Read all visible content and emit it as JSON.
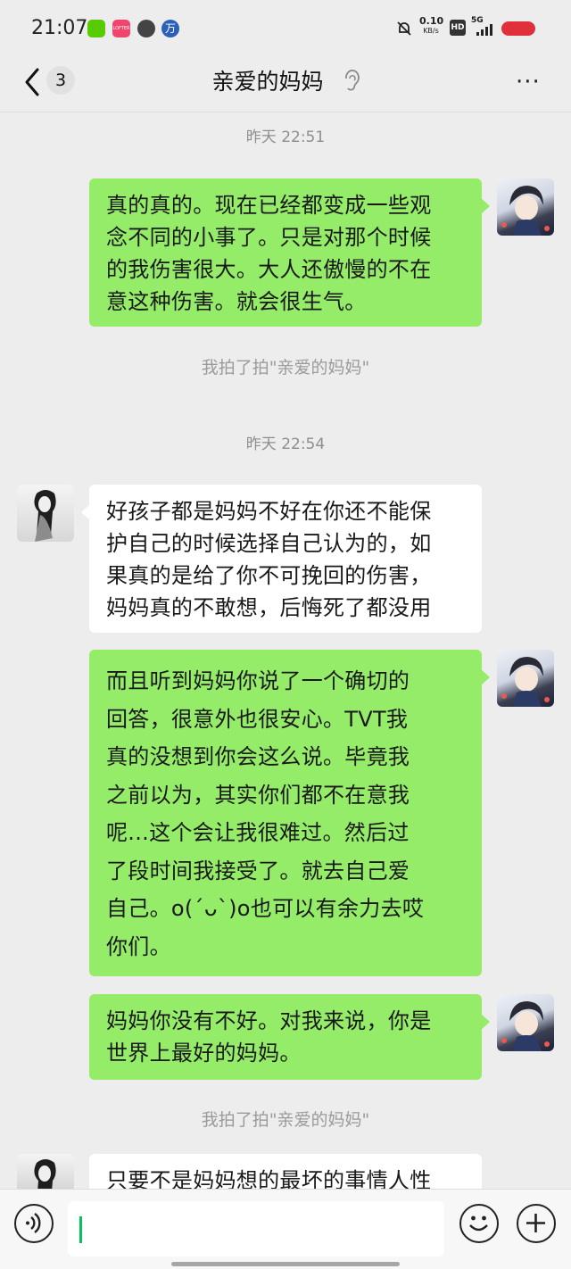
{
  "status_bar": {
    "time": "21:07",
    "net_speed_top": "0.10",
    "net_speed_bottom": "KB/s",
    "hd_label": "HD",
    "network_label": "5G",
    "app_icons": [
      "duolingo-icon",
      "lofter-icon",
      "camera-app-icon",
      "wanfang-icon"
    ],
    "wanfang_glyph": "万",
    "lofter_glyph": "LOFTER"
  },
  "header": {
    "unread_count": "3",
    "title": "亲爱的妈妈",
    "more_glyph": "···"
  },
  "colors": {
    "outgoing_bubble": "#95ec69",
    "incoming_bubble": "#ffffff",
    "background": "#ededed",
    "cursor": "#07c160",
    "battery": "#e0303a"
  },
  "messages": [
    {
      "type": "timestamp",
      "text": "昨天 22:51"
    },
    {
      "type": "outgoing",
      "lines": [
        "真的真的。现在已经都变成一些观",
        "念不同的小事了。只是对那个时候",
        "的我伤害很大。大人还傲慢的不在",
        "意这种伤害。就会很生气。"
      ]
    },
    {
      "type": "system",
      "text": "我拍了拍\"亲爱的妈妈\""
    },
    {
      "type": "timestamp",
      "text": "昨天 22:54"
    },
    {
      "type": "incoming",
      "lines": [
        "好孩子都是妈妈不好在你还不能保",
        "护自己的时候选择自己认为的，如",
        "果真的是给了你不可挽回的伤害，",
        "妈妈真的不敢想，后悔死了都没用"
      ]
    },
    {
      "type": "outgoing",
      "lines": [
        "而且听到妈妈你说了一个确切的",
        "回答，很意外也很安心。TVT我",
        "真的没想到你会这么说。毕竟我",
        "之前以为，其实你们都不在意我",
        "呢...这个会让我很难过。然后过",
        "了段时间我接受了。就去自己爱",
        "自己。o(ˊᴗˋ)o也可以有余力去哎",
        "你们。"
      ]
    },
    {
      "type": "outgoing",
      "lines": [
        "妈妈你没有不好。对我来说，你是",
        "世界上最好的妈妈。"
      ]
    },
    {
      "type": "system",
      "text": "我拍了拍\"亲爱的妈妈\""
    },
    {
      "type": "incoming",
      "lines": [
        "只要不是妈妈想的最坏的事情人性"
      ]
    }
  ],
  "input_bar": {
    "voice_icon": "voice-icon",
    "emoji_icon": "emoji-icon",
    "plus_icon": "plus-icon",
    "text_value": ""
  }
}
